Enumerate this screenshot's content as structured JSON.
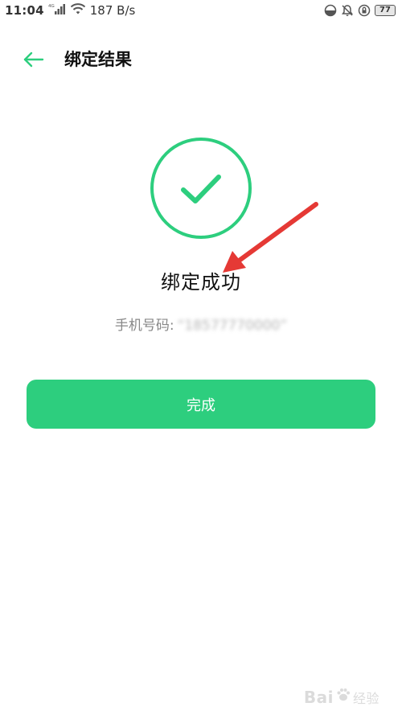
{
  "status_bar": {
    "time": "11:04",
    "network_type": "4G",
    "speed": "187 B/s",
    "battery": "77"
  },
  "header": {
    "title": "绑定结果"
  },
  "result": {
    "title": "绑定成功",
    "phone_label": "手机号码:",
    "phone_value": "“18577770000”"
  },
  "actions": {
    "done_label": "完成"
  },
  "watermark": {
    "brand": "Bai",
    "suffix": "经验"
  },
  "colors": {
    "accent": "#2dce7e",
    "arrow": "#e53935"
  },
  "icons": {
    "back": "arrow-left-icon",
    "success": "check-circle-icon"
  }
}
